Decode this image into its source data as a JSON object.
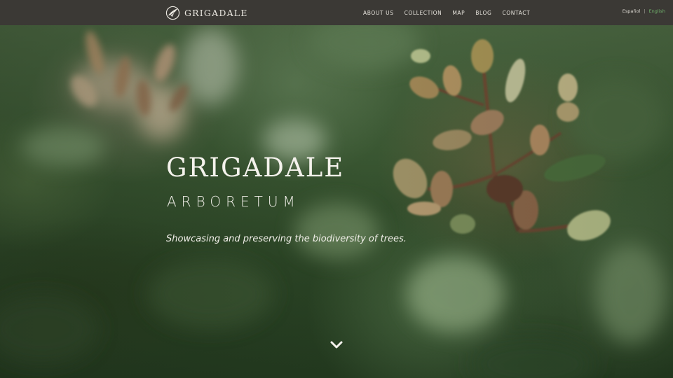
{
  "brand": {
    "name": "GRIGADALE",
    "icon": "leaf-swoosh-logo-icon"
  },
  "nav": {
    "items": [
      {
        "label": "ABOUT US"
      },
      {
        "label": "COLLECTION"
      },
      {
        "label": "MAP"
      },
      {
        "label": "BLOG"
      },
      {
        "label": "CONTACT"
      }
    ]
  },
  "language": {
    "spanish": "Español",
    "separator": "|",
    "english": "English",
    "active": "English",
    "active_color": "#6fae6a"
  },
  "hero": {
    "title": "GRIGADALE",
    "subtitle": "ARBORETUM",
    "tagline": "Showcasing and preserving the biodiversity of trees.",
    "scroll_icon": "chevron-down-icon"
  },
  "colors": {
    "topbar": "#3b3935",
    "text_light": "#f4f2ec"
  }
}
